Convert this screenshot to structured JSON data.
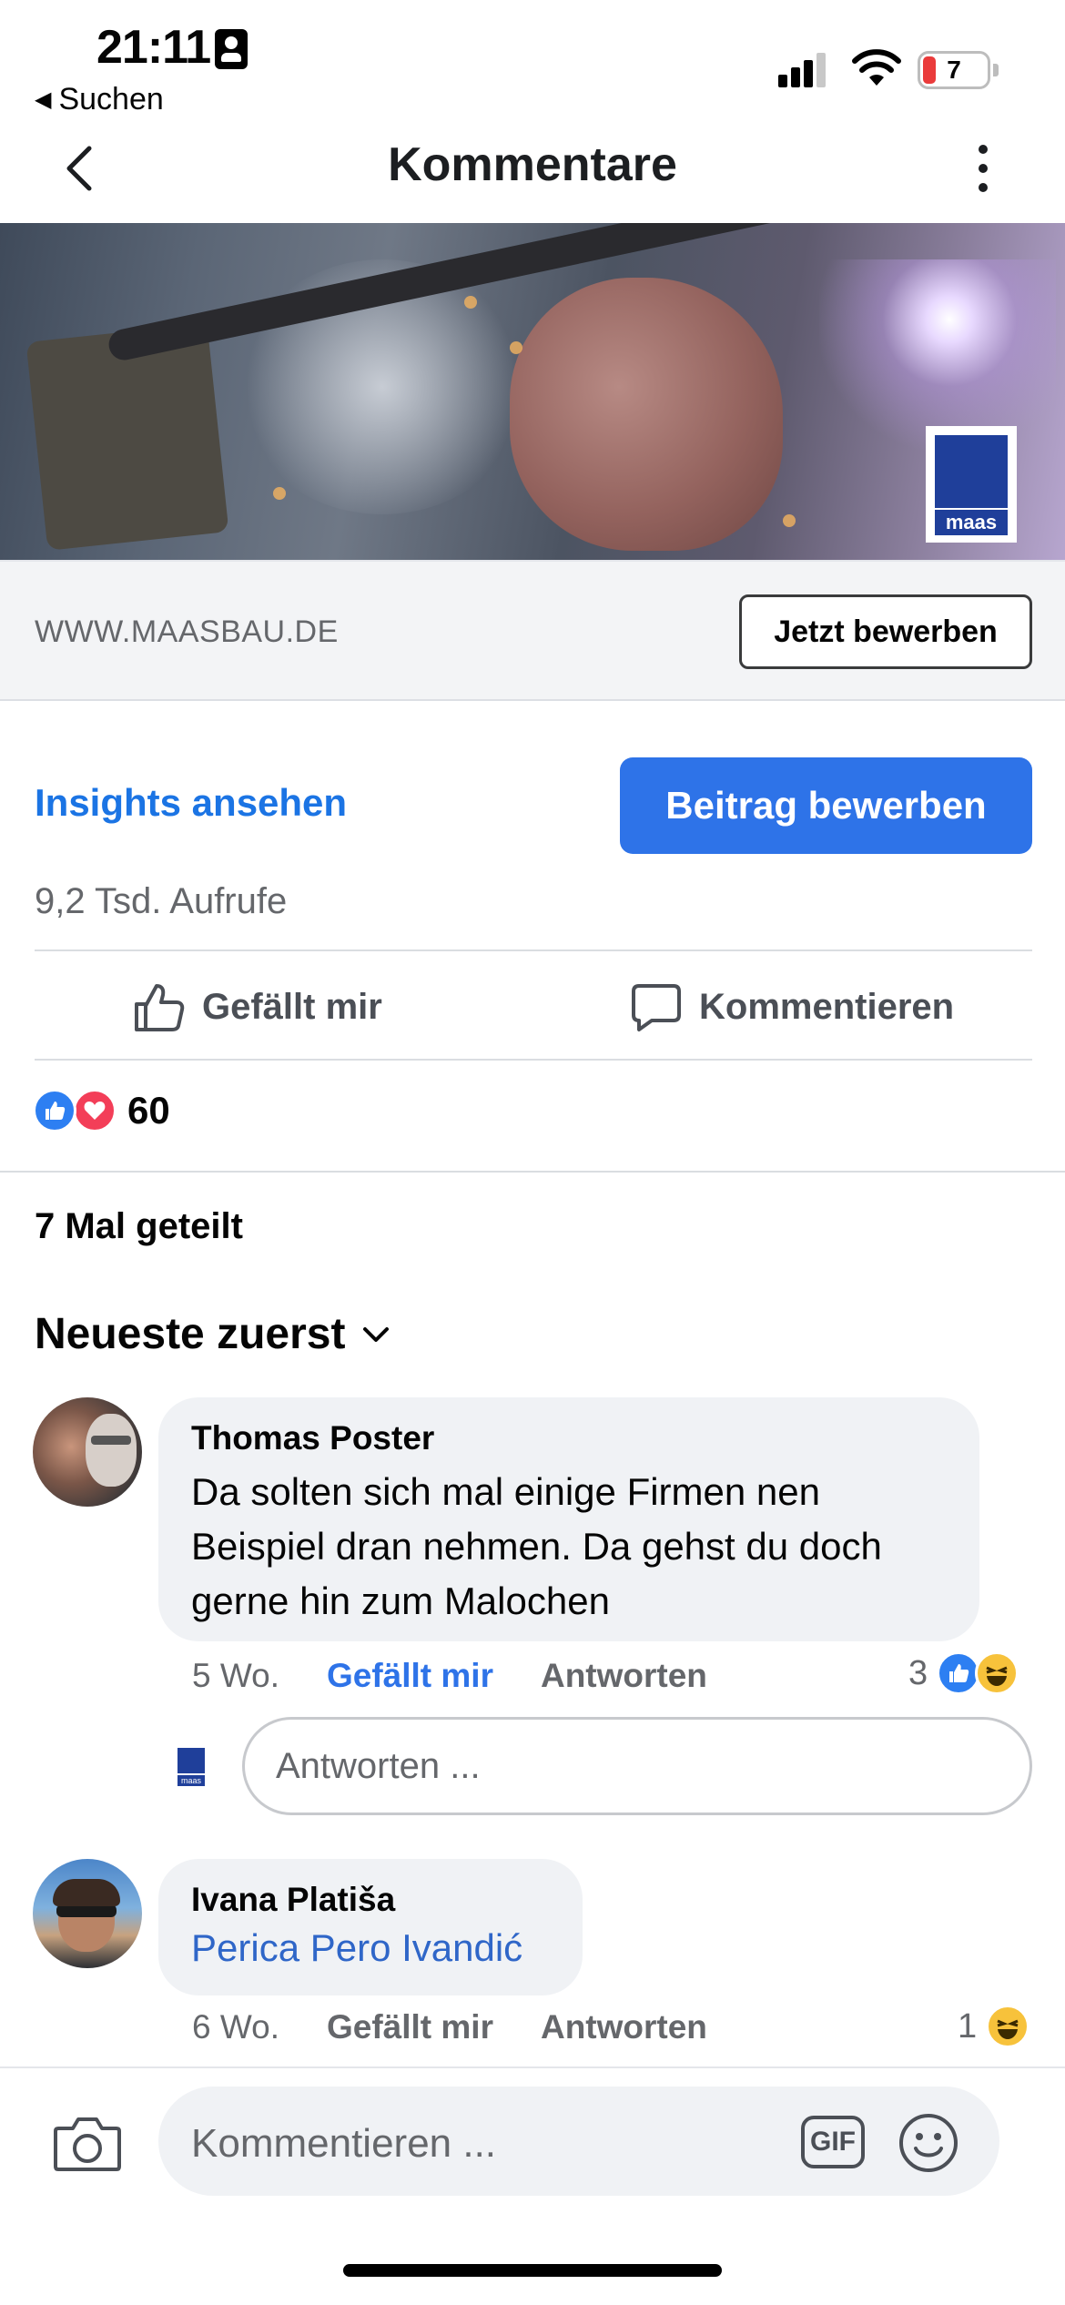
{
  "status_bar": {
    "time": "21:11",
    "back_label": "Suchen",
    "battery": "7"
  },
  "header": {
    "title": "Kommentare"
  },
  "post": {
    "logo_text": "maas",
    "link_url": "WWW.MAASBAU.DE",
    "cta_label": "Jetzt bewerben",
    "insights_label": "Insights ansehen",
    "boost_label": "Beitrag bewerben",
    "views": "9,2 Tsd. Aufrufe",
    "like_label": "Gefällt mir",
    "comment_label": "Kommentieren",
    "reaction_count": "60",
    "shares": "7 Mal geteilt"
  },
  "sort": {
    "label": "Neueste zuerst"
  },
  "comments": [
    {
      "author": "Thomas Poster",
      "text": "Da solten sich mal einige Firmen nen Beispiel dran nehmen. Da gehst du doch gerne hin zum Malochen",
      "time": "5 Wo.",
      "like_label": "Gefällt mir",
      "reply_label": "Antworten",
      "reaction_count": "3"
    },
    {
      "author": "Ivana Platiša",
      "mention": "Perica Pero Ivandić",
      "time": "6 Wo.",
      "like_label": "Gefällt mir",
      "reply_label": "Antworten",
      "reaction_count": "1"
    }
  ],
  "reply_box": {
    "placeholder": "Antworten ..."
  },
  "composer": {
    "placeholder": "Kommentieren ...",
    "gif_label": "GIF"
  },
  "colors": {
    "accent": "#2e73e8",
    "link": "#1b74e4",
    "brand": "#1f3f9a"
  }
}
